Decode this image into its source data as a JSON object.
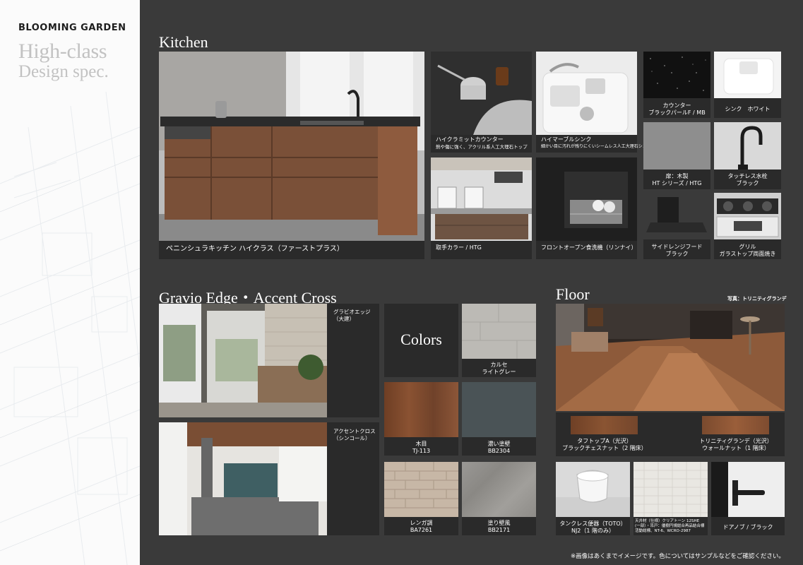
{
  "brand": "BLOOMING GARDEN",
  "tagline_1": "High-class",
  "tagline_2": "Design spec.",
  "kitchen": {
    "title": "Kitchen",
    "main_caption": "ペニンシュラキッチン ハイクラス（ファーストプラス）",
    "counter_caption_1": "ハイクラミットカウンター",
    "counter_caption_2": "熱や傷に強く、アクリル系人工大理石トップ",
    "sink_caption_1": "ハイマーブルシンク",
    "sink_caption_2": "細かい目に汚れが残りにくいシームレス人工大理石シンク",
    "handle_color_caption": "取手カラー / HTG",
    "dishwasher_caption": "フロントオープン食洗機（リンナイ）",
    "counter_color_1": "カウンター",
    "counter_color_2": "ブラックパールF / MB",
    "sink_white": "シンク　ホワイト",
    "door_1": "扉：木製",
    "door_2": "HT シリーズ / HTG",
    "faucet_1": "タッチレス水栓",
    "faucet_2": "ブラック",
    "hood_1": "サイドレンジフード",
    "hood_2": "ブラック",
    "grill_1": "グリル",
    "grill_2": "ガラストップ両面焼き"
  },
  "gravio": {
    "title": "Gravio Edge・Accent Cross",
    "edge_1": "グラビオエッジ",
    "edge_2": "（大建）",
    "cross_1": "アクセントクロス",
    "cross_2": "（シンコール）",
    "colors_title": "Colors",
    "swatches": [
      {
        "line1": "カルセ",
        "line2": "ライトグレー"
      },
      {
        "line1": "木目",
        "line2": "TJ-113"
      },
      {
        "line1": "濃い塗壁",
        "line2": "BB2304"
      },
      {
        "line1": "レンガ調",
        "line2": "BA7261"
      },
      {
        "line1": "塗り壁風",
        "line2": "BB2171"
      }
    ]
  },
  "floor": {
    "title": "Floor",
    "photo_credit": "写真：トリニティグランデ",
    "floor_a_1": "タフトップA（光沢）",
    "floor_a_2": "ブラックチェスナット（2 階床）",
    "floor_b_1": "トリニティグランデ（光沢）",
    "floor_b_2": "ウォールナット（1 階床）",
    "toilet_1": "タンクレス便器（TOTO）",
    "toilet_2": "NJ2（1 階のみ）",
    "tile_1": "天井材（仕様）クリアトーン 12SHE",
    "tile_2": "(一部）・吊戸：優樹円規総合再品結合標",
    "tile_3": "活動総標、NT-6、WCRO-2987",
    "door_knob": "ドアノブ / ブラック"
  },
  "footer_note": "※画像はあくまでイメージです。色についてはサンプルなどをご確認ください。"
}
